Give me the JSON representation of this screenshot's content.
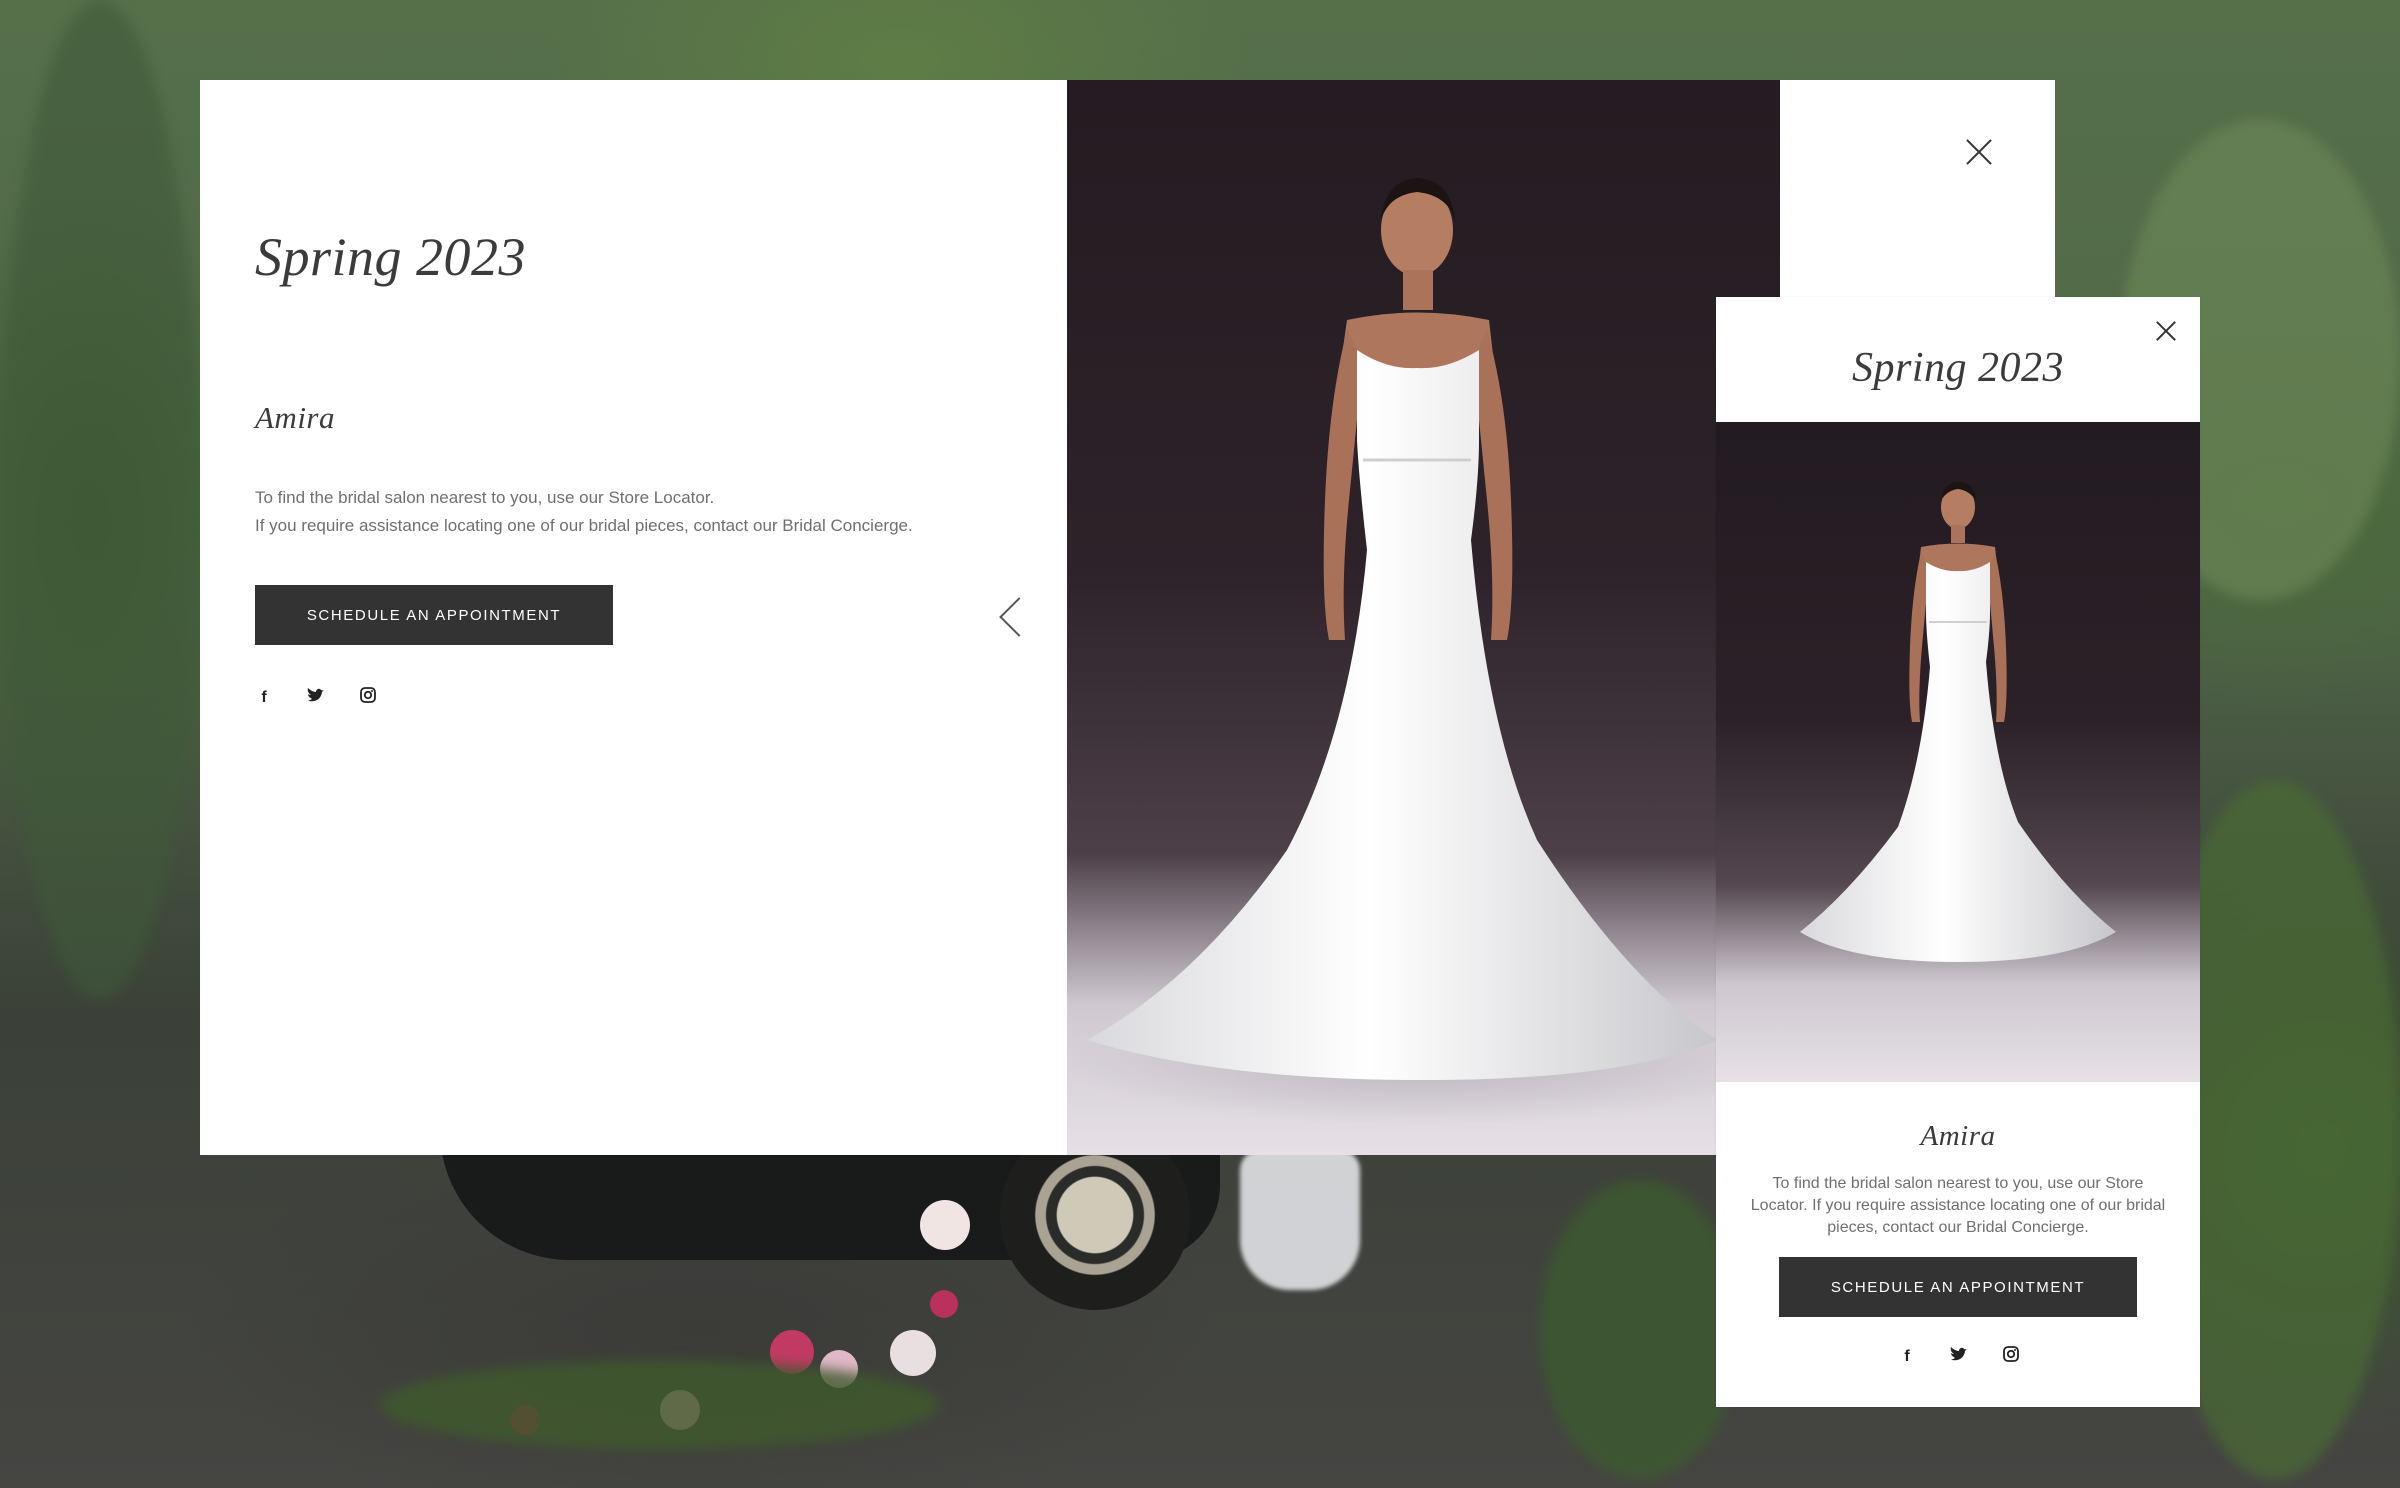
{
  "desktop": {
    "collection_title": "Spring 2023",
    "gown_name": "Amira",
    "description_line1": "To find the bridal salon nearest to you, use our Store Locator.",
    "description_line2": "If you require assistance locating one of our bridal pieces, contact our Bridal Concierge.",
    "cta_label": "SCHEDULE AN APPOINTMENT",
    "social": [
      "f",
      "twitter",
      "instagram"
    ]
  },
  "mobile": {
    "collection_title": "Spring 2023",
    "gown_name": "Amira",
    "description": "To find the bridal salon nearest to you, use our Store Locator. If you require assistance locating one of our bridal pieces, contact our Bridal Concierge.",
    "cta_label": "SCHEDULE AN APPOINTMENT"
  },
  "icons": {
    "close": "close-icon",
    "prev": "chevron-left-icon",
    "facebook": "facebook-icon",
    "twitter": "twitter-icon",
    "instagram": "instagram-icon"
  },
  "colors": {
    "button_bg": "#333333",
    "button_text": "#ffffff",
    "title_text": "#3b3b3b",
    "body_text": "#6f6f6f"
  }
}
